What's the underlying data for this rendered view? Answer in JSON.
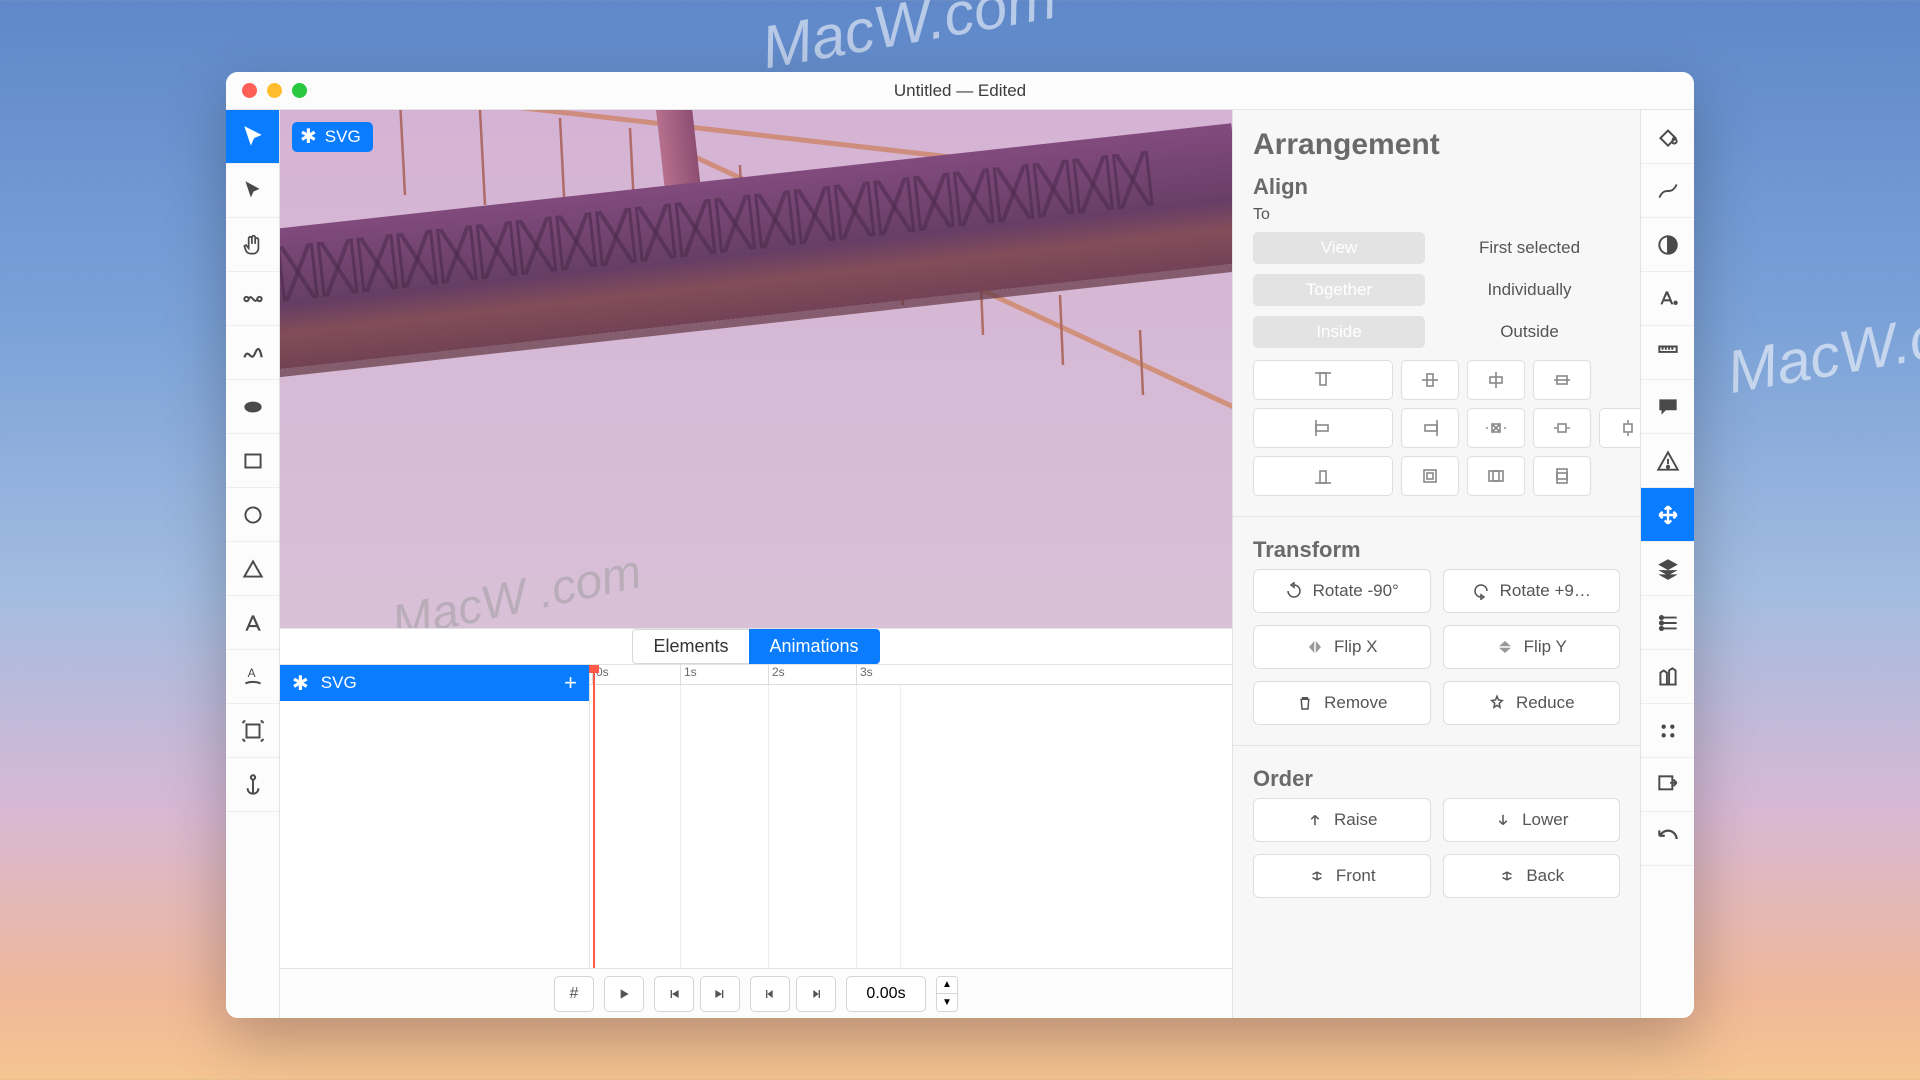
{
  "window": {
    "title": "Untitled — Edited"
  },
  "canvas": {
    "selection_badge": "SVG"
  },
  "tabs": {
    "elements": "Elements",
    "animations": "Animations"
  },
  "layers": {
    "item1": "SVG"
  },
  "timeline": {
    "t0": "0s",
    "t1": "1s",
    "t2": "2s",
    "t3": "3s"
  },
  "transport": {
    "hash": "#",
    "time": "0.00s"
  },
  "inspector": {
    "title": "Arrangement",
    "align": {
      "heading": "Align",
      "to": "To",
      "view": "View",
      "first_selected": "First selected",
      "together": "Together",
      "individually": "Individually",
      "inside": "Inside",
      "outside": "Outside"
    },
    "transform": {
      "heading": "Transform",
      "rot_minus": "Rotate -90°",
      "rot_plus": "Rotate +9…",
      "flip_x": "Flip X",
      "flip_y": "Flip Y",
      "remove": "Remove",
      "reduce": "Reduce"
    },
    "order": {
      "heading": "Order",
      "raise": "Raise",
      "lower": "Lower",
      "front": "Front",
      "back": "Back"
    }
  },
  "watermarks": {
    "a": "MacW.com",
    "b": "MacW.c",
    "c": "MacW .com"
  }
}
